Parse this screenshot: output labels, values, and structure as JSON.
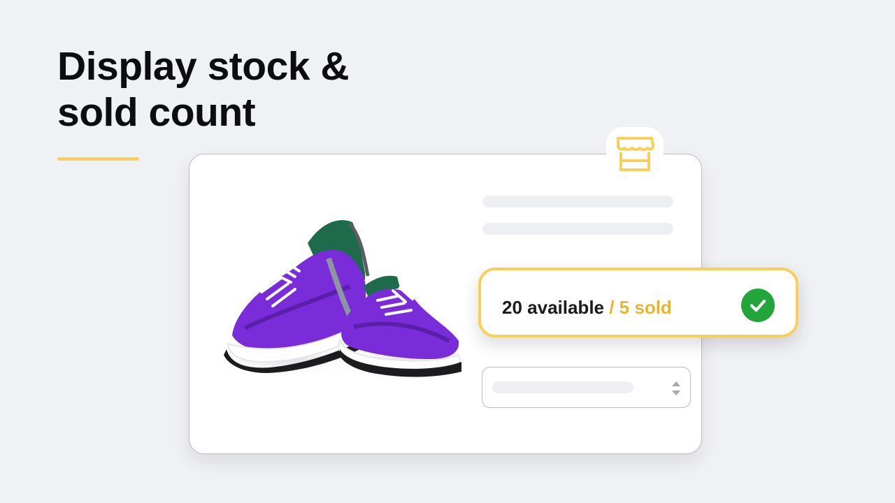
{
  "headline": {
    "line1": "Display stock &",
    "line2": "sold count"
  },
  "colors": {
    "background": "#f0f1f5",
    "accent_yellow": "#f8cf58",
    "sold_yellow": "#e9b42e",
    "check_green": "#22a63b",
    "headline_text": "#0d0d0f",
    "product_purple": "#7b2cd9"
  },
  "store_badge": {
    "icon": "storefront-icon"
  },
  "product": {
    "image": "purple-running-shoes"
  },
  "stock_widget": {
    "available_text": "20 available",
    "separator": " / ",
    "sold_text": "5 sold",
    "status_icon": "check-circle-icon"
  },
  "variant_select": {
    "icon": "sort-arrows-icon"
  }
}
